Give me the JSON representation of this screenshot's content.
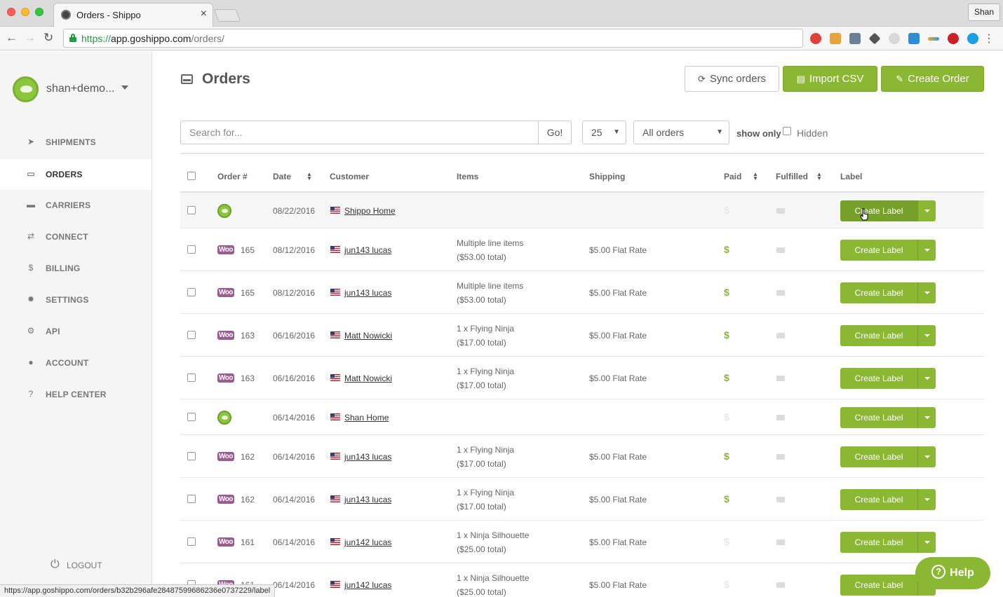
{
  "browser": {
    "tab_title": "Orders - Shippo",
    "url_scheme": "https://",
    "url_host": "app.goshippo.com",
    "url_path": "/orders/",
    "profile": "Shan",
    "status_url": "https://app.goshippo.com/orders/b32b296afe28487599686236e0737229/label"
  },
  "sidebar": {
    "account_name": "shan+demo...",
    "items": [
      {
        "label": "SHIPMENTS",
        "icon": "paper-plane-icon"
      },
      {
        "label": "ORDERS",
        "icon": "inbox-icon"
      },
      {
        "label": "CARRIERS",
        "icon": "truck-icon"
      },
      {
        "label": "CONNECT",
        "icon": "exchange-icon"
      },
      {
        "label": "BILLING",
        "icon": "dollar-icon"
      },
      {
        "label": "SETTINGS",
        "icon": "gear-icon"
      },
      {
        "label": "API",
        "icon": "gears-icon"
      },
      {
        "label": "ACCOUNT",
        "icon": "user-icon"
      },
      {
        "label": "HELP CENTER",
        "icon": "question-icon"
      }
    ],
    "active": "ORDERS",
    "logout": "LOGOUT"
  },
  "header": {
    "title": "Orders",
    "sync": "Sync orders",
    "import": "Import CSV",
    "create_order": "Create Order"
  },
  "filters": {
    "search_placeholder": "Search for...",
    "go": "Go!",
    "per_page": "25",
    "status": "All orders",
    "show_only": "show only",
    "hidden": "Hidden"
  },
  "table": {
    "columns": [
      "Order #",
      "Date",
      "Customer",
      "Items",
      "Shipping",
      "Paid",
      "Fulfilled",
      "Label"
    ],
    "create_label": "Create Label",
    "rows": [
      {
        "source": "shippo",
        "order": "",
        "date": "08/22/2016",
        "customer": "Shippo Home",
        "items": [
          "",
          ""
        ],
        "shipping": "",
        "paid": false
      },
      {
        "source": "woo",
        "order": "165",
        "date": "08/12/2016",
        "customer": "jun143 lucas",
        "items": [
          "Multiple line items",
          "($53.00 total)"
        ],
        "shipping": "$5.00 Flat Rate",
        "paid": true
      },
      {
        "source": "woo",
        "order": "165",
        "date": "08/12/2016",
        "customer": "jun143 lucas",
        "items": [
          "Multiple line items",
          "($53.00 total)"
        ],
        "shipping": "$5.00 Flat Rate",
        "paid": true
      },
      {
        "source": "woo",
        "order": "163",
        "date": "06/16/2016",
        "customer": "Matt Nowicki",
        "items": [
          "1 x Flying Ninja",
          "($17.00 total)"
        ],
        "shipping": "$5.00 Flat Rate",
        "paid": true
      },
      {
        "source": "woo",
        "order": "163",
        "date": "06/16/2016",
        "customer": "Matt Nowicki",
        "items": [
          "1 x Flying Ninja",
          "($17.00 total)"
        ],
        "shipping": "$5.00 Flat Rate",
        "paid": true
      },
      {
        "source": "shippo",
        "order": "",
        "date": "06/14/2016",
        "customer": "Shan Home",
        "items": [
          "",
          ""
        ],
        "shipping": "",
        "paid": false
      },
      {
        "source": "woo",
        "order": "162",
        "date": "06/14/2016",
        "customer": "jun143 lucas",
        "items": [
          "1 x Flying Ninja",
          "($17.00 total)"
        ],
        "shipping": "$5.00 Flat Rate",
        "paid": true
      },
      {
        "source": "woo",
        "order": "162",
        "date": "06/14/2016",
        "customer": "jun143 lucas",
        "items": [
          "1 x Flying Ninja",
          "($17.00 total)"
        ],
        "shipping": "$5.00 Flat Rate",
        "paid": true
      },
      {
        "source": "woo",
        "order": "161",
        "date": "06/14/2016",
        "customer": "jun142 lucas",
        "items": [
          "1 x Ninja Silhouette",
          "($25.00 total)"
        ],
        "shipping": "$5.00 Flat Rate",
        "paid": false
      },
      {
        "source": "woo",
        "order": "161",
        "date": "06/14/2016",
        "customer": "jun142 lucas",
        "items": [
          "1 x Ninja Silhouette",
          "($25.00 total)"
        ],
        "shipping": "$5.00 Flat Rate",
        "paid": false
      }
    ]
  },
  "help": "Help",
  "woo_badge": "Woo",
  "paid_symbol": "$"
}
